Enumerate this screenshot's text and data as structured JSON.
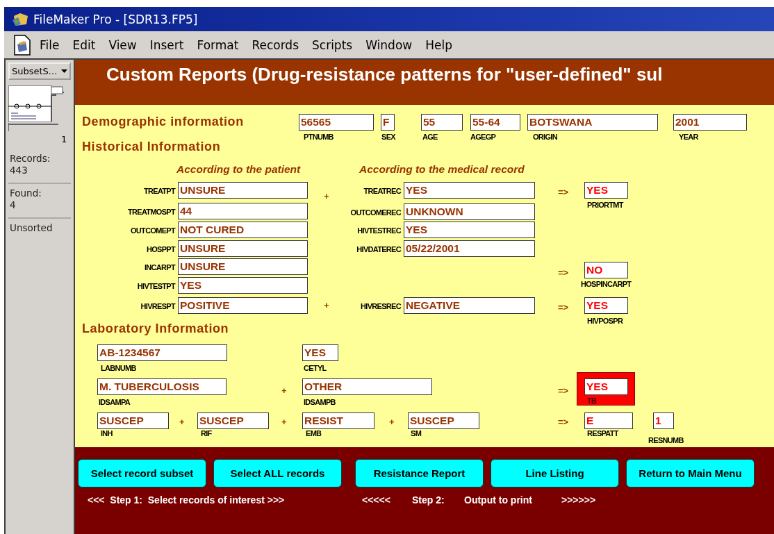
{
  "window": {
    "title": "FileMaker Pro - [SDR13.FP5]"
  },
  "menu": [
    "File",
    "Edit",
    "View",
    "Insert",
    "Format",
    "Records",
    "Scripts",
    "Window",
    "Help"
  ],
  "status_area": {
    "layout_menu": "SubsetS...",
    "record_number": "1",
    "records_label": "Records:",
    "records_count": "443",
    "found_label": "Found:",
    "found_count": "4",
    "sort_status": "Unsorted"
  },
  "header": {
    "title": "Custom Reports (Drug-resistance patterns for \"user-defined\" sul"
  },
  "layout_objects": [
    {
      "kind": "heading",
      "text": "Demographic information"
    },
    {
      "kind": "data_field",
      "value": "56565",
      "label": "PTNUMB"
    },
    {
      "kind": "data_field",
      "value": "F",
      "label": "SEX"
    },
    {
      "kind": "data_field",
      "value": "55",
      "label": "AGE"
    },
    {
      "kind": "data_field",
      "value": "55-64",
      "label": "AGEGP"
    },
    {
      "kind": "data_field",
      "value": "BOTSWANA",
      "label": "ORIGIN"
    },
    {
      "kind": "data_field",
      "value": "2001",
      "label": "YEAR"
    },
    {
      "kind": "heading",
      "text": "Historical Information"
    },
    {
      "kind": "column_heading",
      "text": "According to the patient"
    },
    {
      "kind": "column_heading",
      "text": "According to the medical record"
    },
    {
      "kind": "data_field",
      "value": "UNSURE",
      "label": "TREATPT"
    },
    {
      "kind": "operator",
      "text": "+"
    },
    {
      "kind": "data_field",
      "value": "YES",
      "label": "TREATREC"
    },
    {
      "kind": "operator",
      "text": "=>"
    },
    {
      "kind": "result_field",
      "value": "YES",
      "label": "PRIORTMT"
    },
    {
      "kind": "data_field",
      "value": "44",
      "label": "TREATMOSPT"
    },
    {
      "kind": "data_field",
      "value": "UNKNOWN",
      "label": "OUTCOMEREC"
    },
    {
      "kind": "data_field",
      "value": "NOT CURED",
      "label": "OUTCOMEPT"
    },
    {
      "kind": "data_field",
      "value": "YES",
      "label": "HIVTESTREC"
    },
    {
      "kind": "data_field",
      "value": "UNSURE",
      "label": "HOSPPT"
    },
    {
      "kind": "data_field",
      "value": "05/22/2001",
      "label": "HIVDATEREC"
    },
    {
      "kind": "data_field",
      "value": "UNSURE",
      "label": "INCARPT"
    },
    {
      "kind": "data_field",
      "value": "YES",
      "label": "HIVTESTPT"
    },
    {
      "kind": "operator",
      "text": "=>"
    },
    {
      "kind": "result_field",
      "value": "NO",
      "label": "HOSPINCARPT"
    },
    {
      "kind": "data_field",
      "value": "POSITIVE",
      "label": "HIVRESPT"
    },
    {
      "kind": "operator",
      "text": "+"
    },
    {
      "kind": "data_field",
      "value": "NEGATIVE",
      "label": "HIVRESREC"
    },
    {
      "kind": "operator",
      "text": "=>"
    },
    {
      "kind": "result_field",
      "value": "YES",
      "label": "HIVPOSPR"
    },
    {
      "kind": "heading",
      "text": "Laboratory Information"
    },
    {
      "kind": "data_field",
      "value": "AB-1234567",
      "label": "LABNUMB"
    },
    {
      "kind": "data_field",
      "value": "YES",
      "label": "CETYL"
    },
    {
      "kind": "data_field",
      "value": "M. TUBERCULOSIS",
      "label": "IDSAMPA"
    },
    {
      "kind": "operator",
      "text": "+"
    },
    {
      "kind": "data_field",
      "value": "OTHER",
      "label": "IDSAMPB"
    },
    {
      "kind": "operator",
      "text": "=>"
    },
    {
      "kind": "alert_field",
      "value": "YES",
      "label": "TB"
    },
    {
      "kind": "data_field",
      "value": "SUSCEP",
      "label": "INH"
    },
    {
      "kind": "operator",
      "text": "+"
    },
    {
      "kind": "data_field",
      "value": "SUSCEP",
      "label": "RIF"
    },
    {
      "kind": "operator",
      "text": "+"
    },
    {
      "kind": "data_field",
      "value": "RESIST",
      "label": "EMB"
    },
    {
      "kind": "operator",
      "text": "+"
    },
    {
      "kind": "data_field",
      "value": "SUSCEP",
      "label": "SM"
    },
    {
      "kind": "operator",
      "text": "=>"
    },
    {
      "kind": "result_field",
      "value": "E",
      "label": "RESPATT"
    },
    {
      "kind": "result_field",
      "value": "1",
      "label": "RESNUMB"
    }
  ],
  "buttons": [
    "Select record subset",
    "Select ALL records",
    "Resistance Report",
    "Line Listing",
    "Return to Main Menu"
  ],
  "step_notes": [
    "<<<  Step 1:  Select records of interest >>>",
    "<<<<<",
    "Step 2:",
    "Output to print",
    ">>>>>>"
  ]
}
